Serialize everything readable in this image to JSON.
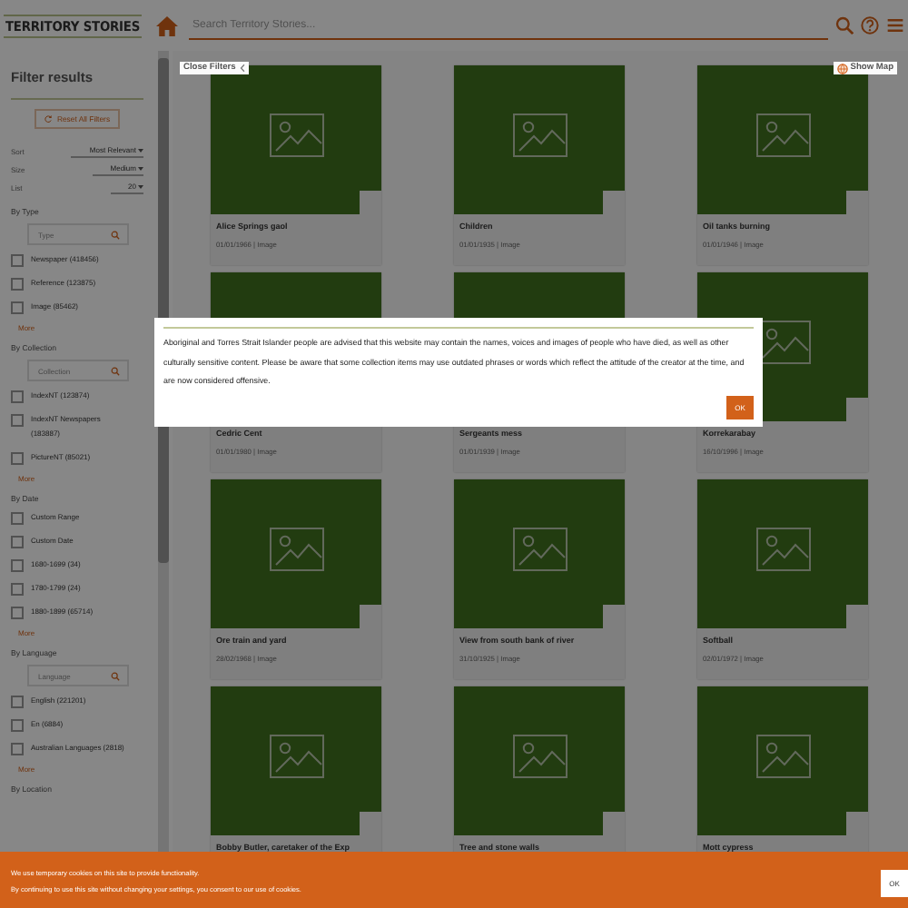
{
  "header": {
    "logo": "TERRITORY STORIES",
    "search": {
      "placeholder": "Search Territory Stories..."
    }
  },
  "filters": {
    "title": "Filter results",
    "reset": "Reset All Filters",
    "selects": [
      {
        "label": "Sort",
        "value": "Most Relevant"
      },
      {
        "label": "Size",
        "value": "Medium"
      },
      {
        "label": "List",
        "value": "20"
      }
    ],
    "sections": [
      {
        "title": "By Type",
        "search": {
          "placeholder": "Type"
        },
        "options": [
          {
            "label": "Newspaper (418456)",
            "checked": false
          },
          {
            "label": "Reference (123875)",
            "checked": false
          },
          {
            "label": "Image (85462)",
            "checked": false
          }
        ],
        "more": "More"
      },
      {
        "title": "By Collection",
        "search": {
          "placeholder": "Collection"
        },
        "options": [
          {
            "label": "IndexNT (123874)",
            "checked": false
          },
          {
            "label": "IndexNT Newspapers (183887)",
            "checked": false
          },
          {
            "label": "PictureNT (85021)",
            "checked": false
          }
        ],
        "more": "More"
      },
      {
        "title": "By Date",
        "options": [
          {
            "label": "Custom Range",
            "checked": false
          },
          {
            "label": "Custom Date",
            "checked": false
          },
          {
            "label": "1680-1699 (34)",
            "checked": false
          },
          {
            "label": "1780-1799 (24)",
            "checked": false
          },
          {
            "label": "1880-1899 (65714)",
            "checked": false
          }
        ],
        "more": "More"
      },
      {
        "title": "By Language",
        "search": {
          "placeholder": "Language"
        },
        "options": [
          {
            "label": "English (221201)",
            "checked": false
          },
          {
            "label": "En (6884)",
            "checked": false
          },
          {
            "label": "Australian Languages (2818)",
            "checked": false
          }
        ],
        "more": "More"
      },
      {
        "title": "By Location"
      }
    ]
  },
  "results": {
    "close_filters": "Close Filters",
    "show_map": "Show Map",
    "items": [
      {
        "title": "Alice Springs gaol",
        "meta": "01/01/1966 | Image"
      },
      {
        "title": "Children",
        "meta": "01/01/1935 | Image"
      },
      {
        "title": "Oil tanks burning",
        "meta": "01/01/1946 | Image"
      },
      {
        "title": "Cedric Cent",
        "meta": "01/01/1980 | Image"
      },
      {
        "title": "Sergeants mess",
        "meta": "01/01/1939 | Image"
      },
      {
        "title": "Korrekarabay",
        "meta": "16/10/1996 | Image"
      },
      {
        "title": "Ore train and yard",
        "meta": "28/02/1968 | Image"
      },
      {
        "title": "View from south bank of river",
        "meta": "31/10/1925 | Image"
      },
      {
        "title": "Softball",
        "meta": "02/01/1972 | Image"
      },
      {
        "title": "Bobby Butler, caretaker of the Exp"
      },
      {
        "title": "Tree and stone walls"
      },
      {
        "title": "Mott cypress"
      }
    ]
  },
  "modal": {
    "text": "Aboriginal and Torres Strait Islander people are advised that this website may contain the names, voices and images of people who have died, as well as other culturally sensitive content. Please be aware that some collection items may use outdated phrases or words which reflect the attitude of the creator at the time, and are now considered offensive.",
    "button": "OK"
  },
  "cookie_banner": {
    "lines": [
      "We use temporary cookies on this site to provide functionality.",
      "By continuing to use this site without changing your settings, you consent to our use of cookies."
    ],
    "button": "OK"
  }
}
